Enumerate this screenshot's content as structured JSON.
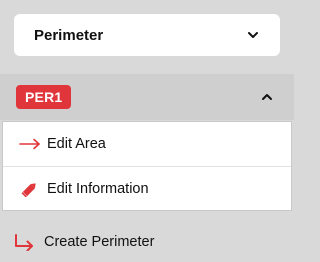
{
  "perimeter_select": {
    "selected": "Perimeter",
    "icon": "chevron-down-icon"
  },
  "perimeter_section": {
    "badge": "PER1",
    "badge_color": "#e0363b",
    "toggle_icon": "chevron-up-icon"
  },
  "menu": {
    "items": [
      {
        "label": "Edit Area",
        "icon": "arrow-right-icon"
      },
      {
        "label": "Edit Information",
        "icon": "pencil-icon"
      }
    ]
  },
  "create": {
    "label": "Create Perimeter",
    "icon": "turn-right-arrow-icon"
  },
  "colors": {
    "accent": "#e0363b",
    "background": "#d9d9d9"
  }
}
